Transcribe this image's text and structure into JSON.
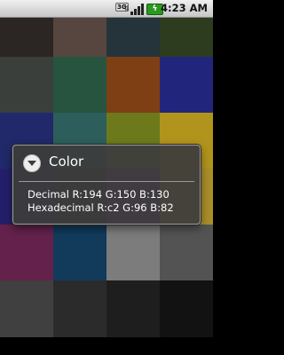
{
  "status_bar": {
    "network_label": "3G",
    "time": "4:23 AM",
    "icons": [
      "network-3g-icon",
      "signal-icon",
      "battery-charging-icon"
    ]
  },
  "swatches": [
    [
      "#2b2624",
      "#574540",
      "#25343a",
      "#2d3b1f"
    ],
    [
      "#3a3f3c",
      "#26543f",
      "#7e3f14",
      "#22257c"
    ],
    [
      "#22296a",
      "#2d5e5b",
      "#6d7a1c",
      "#b1941c"
    ],
    [
      "#241f6b",
      "#3e2c30",
      "#6b2c80",
      "#a98e2a"
    ],
    [
      "#63214b",
      "#113a5b",
      "#7c7c7c",
      "#535353"
    ],
    [
      "#404040",
      "#2b2b2b",
      "#1e1e1e",
      "#121212"
    ]
  ],
  "dialog": {
    "icon": "chevron-down-icon",
    "title": "Color",
    "decimal_text": "Decimal R:194 G:150 B:130",
    "hex_text": "Hexadecimal R:c2 G:96 B:82"
  }
}
